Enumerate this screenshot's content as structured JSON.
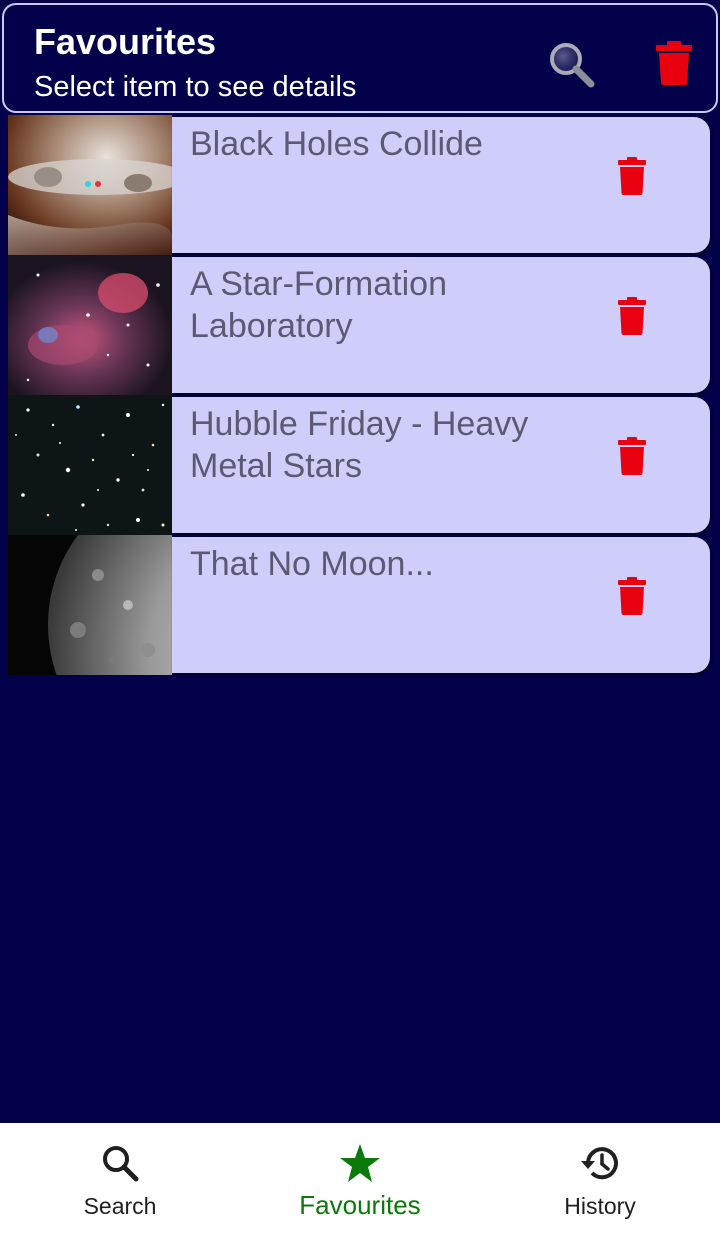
{
  "header": {
    "title": "Favourites",
    "subtitle": "Select item to see details",
    "search_icon": "search-icon",
    "delete_all_icon": "trash-icon"
  },
  "favourites": [
    {
      "title": "Black Holes Collide",
      "image": "black-holes-thumbnail"
    },
    {
      "title": "A Star-Formation Laboratory",
      "image": "nebula-thumbnail"
    },
    {
      "title": "Hubble Friday - Heavy Metal Stars",
      "image": "star-cluster-thumbnail"
    },
    {
      "title": "That No Moon...",
      "image": "moon-thumbnail"
    }
  ],
  "bottom_nav": {
    "items": [
      {
        "label": "Search",
        "icon": "search-icon"
      },
      {
        "label": "Favourites",
        "icon": "star-icon",
        "active": true
      },
      {
        "label": "History",
        "icon": "history-icon"
      }
    ]
  },
  "colors": {
    "background": "#02014a",
    "card": "#cfcefb",
    "delete": "#e8000f",
    "active_nav": "#0b7a0b"
  }
}
